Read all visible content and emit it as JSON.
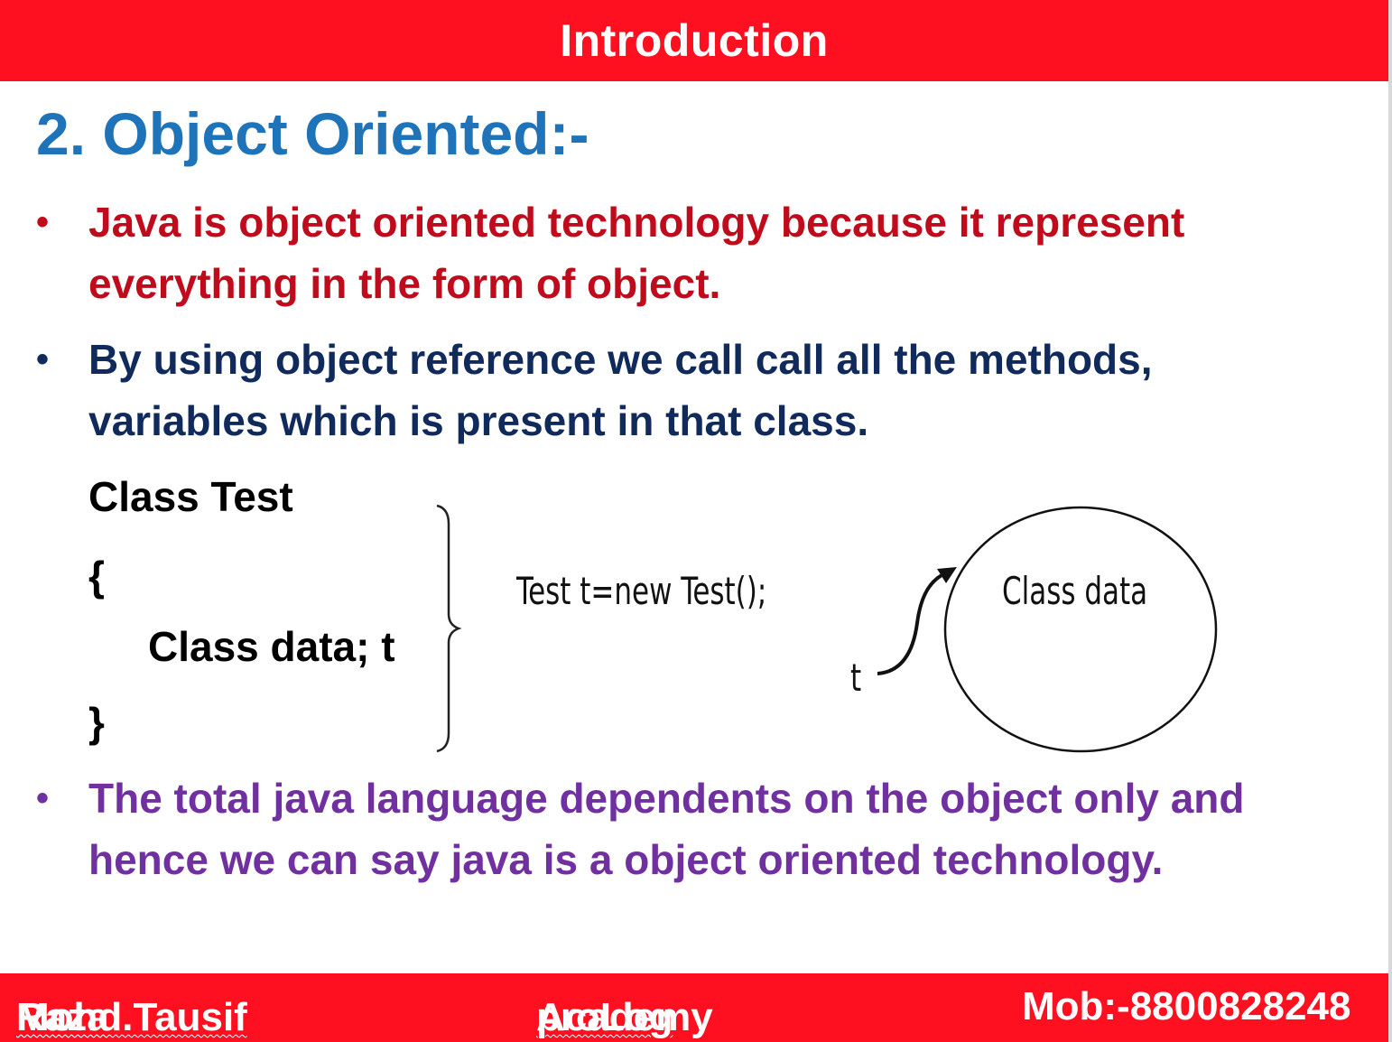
{
  "header": {
    "title": "Introduction"
  },
  "heading": "2. Object Oriented:-",
  "bullets": {
    "b1": "Java is object oriented technology because it represent everything in the form of object.",
    "b2": "By using object reference we call call all the methods, variables which is present in that class.",
    "b3": "The total java language dependents on the object only and  hence we can say java is a object oriented technology.",
    "marker": "•"
  },
  "code": {
    "line1": "Class Test",
    "line2": "{",
    "line3": "Class data; t",
    "line4": "}"
  },
  "diagram": {
    "statement": "Test t=new Test();",
    "object_label": "Class data",
    "ref_label": "t"
  },
  "footer": {
    "author_first": "Mohd.Tausif",
    "author_last": "Raza",
    "academy_brand": "proLog",
    "academy_word": "Academy",
    "mobile": "Mob:-8800828248"
  },
  "colors": {
    "bar": "#ff1020",
    "heading": "#1f73b8",
    "bullet1": "#c00b1d",
    "bullet2": "#102a5c",
    "bullet3": "#7030a0"
  }
}
